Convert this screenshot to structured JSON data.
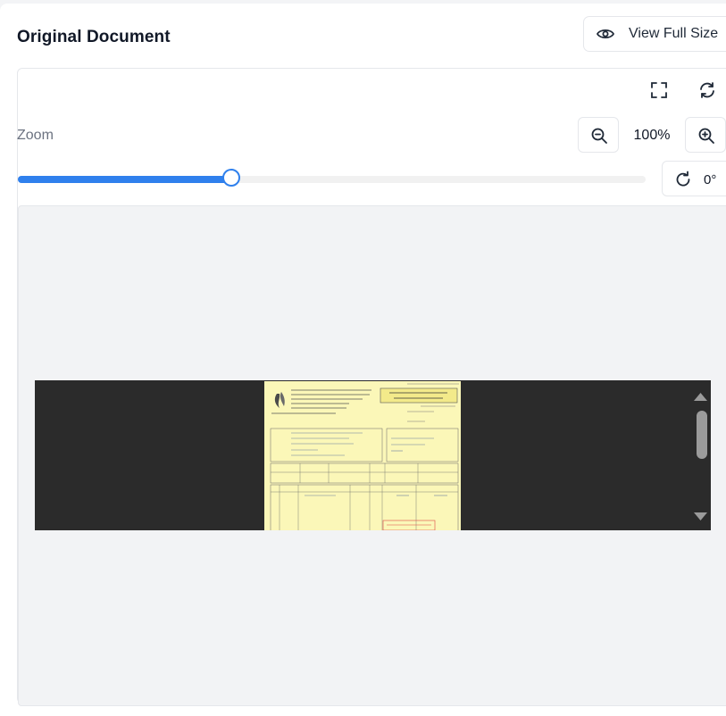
{
  "header": {
    "title": "Original Document",
    "view_full_size_label": "View Full Size"
  },
  "toolbar": {
    "zoom_label": "Zoom",
    "zoom_value": "100%",
    "zoom_level_fraction": 0.34,
    "rotation_value": "0°"
  },
  "icons": {
    "view": "eye-icon",
    "fullscreen": "fullscreen-icon",
    "refresh": "refresh-icon",
    "zoom_out": "zoom-out-icon",
    "zoom_in": "zoom-in-icon",
    "rotate": "rotate-icon"
  },
  "colors": {
    "accent": "#2f80ed",
    "document_bg": "#fbf7b8",
    "viewer_dark": "#2b2b2b"
  }
}
